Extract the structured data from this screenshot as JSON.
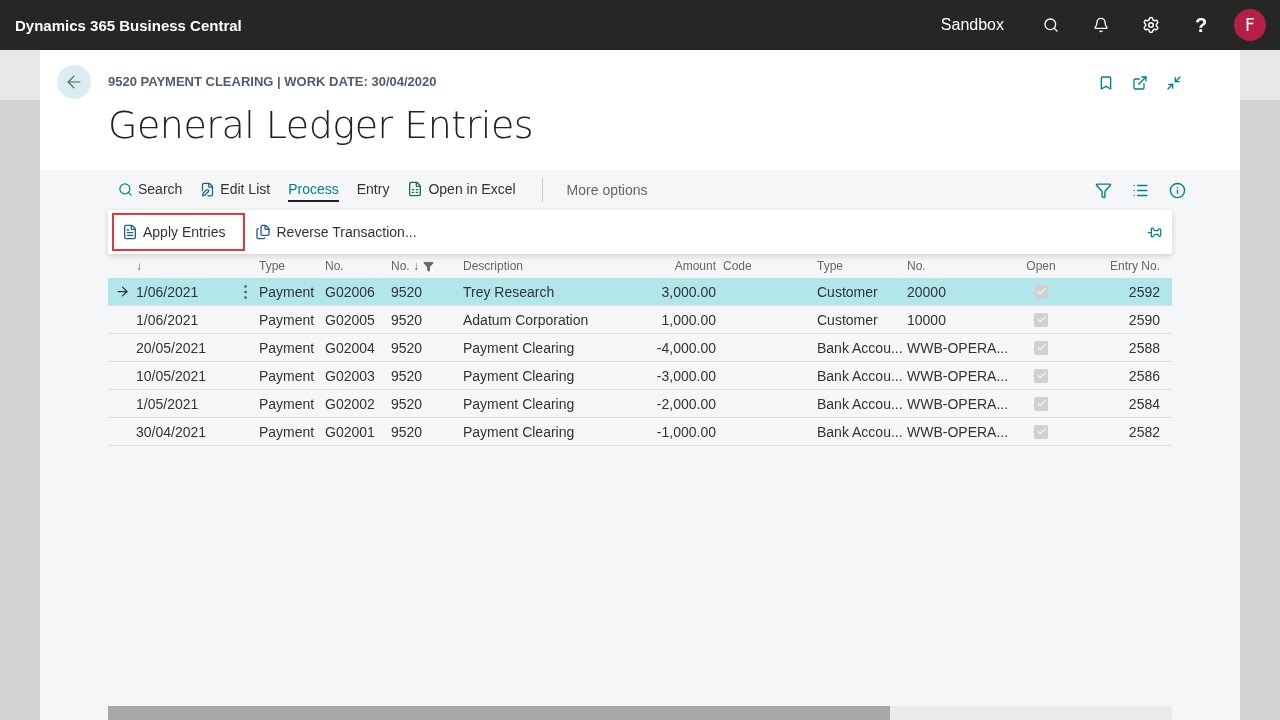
{
  "app_bar": {
    "title": "Dynamics 365 Business Central",
    "environment": "Sandbox",
    "help": "?",
    "avatar": "F"
  },
  "page": {
    "breadcrumb": "9520 PAYMENT CLEARING | WORK DATE: 30/04/2020",
    "title": "General Ledger Entries"
  },
  "actions": [
    {
      "kind": "search",
      "label": "Search",
      "selected": false
    },
    {
      "kind": "edit",
      "label": "Edit List",
      "selected": false
    },
    {
      "kind": "plain",
      "label": "Process",
      "selected": true
    },
    {
      "kind": "plain",
      "label": "Entry",
      "selected": false
    },
    {
      "kind": "excel",
      "label": "Open in Excel",
      "selected": false
    }
  ],
  "more_options": "More options",
  "sub_actions": [
    {
      "kind": "apply",
      "label": "Apply Entries",
      "highlighted": true
    },
    {
      "kind": "reverse",
      "label": "Reverse Transaction...",
      "highlighted": false
    }
  ],
  "table": {
    "columns": [
      {
        "label": "↓",
        "filtered": false
      },
      {
        "label": "Type",
        "filtered": false
      },
      {
        "label": "No.",
        "filtered": false
      },
      {
        "label": "No. ↓",
        "filtered": true
      },
      {
        "label": "Description",
        "filtered": false
      },
      {
        "label": "Amount",
        "filtered": false
      },
      {
        "label": "Code",
        "filtered": false
      },
      {
        "label": "Type",
        "filtered": false
      },
      {
        "label": "No.",
        "filtered": false
      },
      {
        "label": "Open",
        "filtered": false
      },
      {
        "label": "Entry No.",
        "filtered": false
      }
    ],
    "rows": [
      {
        "selected": true,
        "cells": [
          "1/06/2021",
          "Payment",
          "G02006",
          "9520",
          "Trey Research",
          "3,000.00",
          "",
          "Customer",
          "20000"
        ],
        "open": true,
        "entry_no": "2592"
      },
      {
        "selected": false,
        "cells": [
          "1/06/2021",
          "Payment",
          "G02005",
          "9520",
          "Adatum Corporation",
          "1,000.00",
          "",
          "Customer",
          "10000"
        ],
        "open": true,
        "entry_no": "2590"
      },
      {
        "selected": false,
        "cells": [
          "20/05/2021",
          "Payment",
          "G02004",
          "9520",
          "Payment Clearing",
          "-4,000.00",
          "",
          "Bank Accou...",
          "WWB-OPERA..."
        ],
        "open": true,
        "entry_no": "2588"
      },
      {
        "selected": false,
        "cells": [
          "10/05/2021",
          "Payment",
          "G02003",
          "9520",
          "Payment Clearing",
          "-3,000.00",
          "",
          "Bank Accou...",
          "WWB-OPERA..."
        ],
        "open": true,
        "entry_no": "2586"
      },
      {
        "selected": false,
        "cells": [
          "1/05/2021",
          "Payment",
          "G02002",
          "9520",
          "Payment Clearing",
          "-2,000.00",
          "",
          "Bank Accou...",
          "WWB-OPERA..."
        ],
        "open": true,
        "entry_no": "2584"
      },
      {
        "selected": false,
        "cells": [
          "30/04/2021",
          "Payment",
          "G02001",
          "9520",
          "Payment Clearing",
          "-1,000.00",
          "",
          "Bank Accou...",
          "WWB-OPERA..."
        ],
        "open": true,
        "entry_no": "2582"
      }
    ]
  }
}
